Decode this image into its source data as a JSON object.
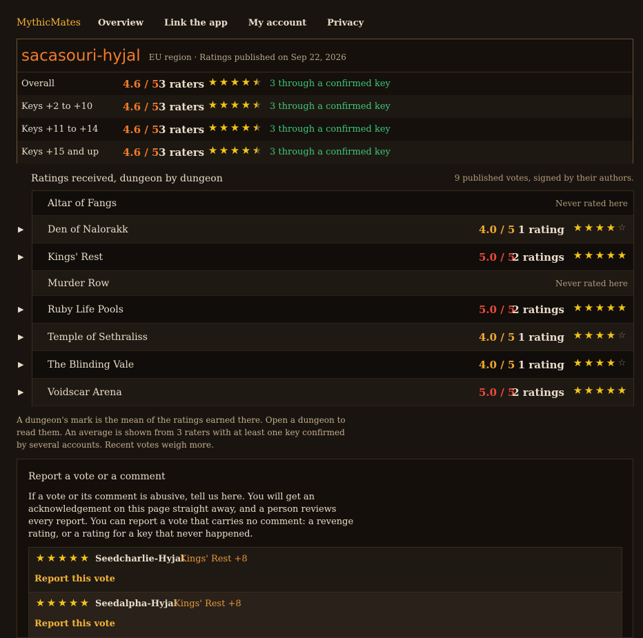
{
  "nav": {
    "brand": "MythicMates",
    "links": [
      "Overview",
      "Link the app",
      "My account",
      "Privacy"
    ]
  },
  "profile": {
    "name": "sacasouri-hyjal",
    "meta": "EU region · Ratings published on Sep 22, 2026",
    "rows": [
      {
        "label": "Overall",
        "score": "4.6 / 5",
        "raters": "3 raters",
        "stars": 4.5,
        "confirmed": "3 through a confirmed key"
      },
      {
        "label": "Keys +2 to +10",
        "score": "4.6 / 5",
        "raters": "3 raters",
        "stars": 4.5,
        "confirmed": "3 through a confirmed key"
      },
      {
        "label": "Keys +11 to +14",
        "score": "4.6 / 5",
        "raters": "3 raters",
        "stars": 4.5,
        "confirmed": "3 through a confirmed key"
      },
      {
        "label": "Keys +15 and up",
        "score": "4.6 / 5",
        "raters": "3 raters",
        "stars": 4.5,
        "confirmed": "3 through a confirmed key"
      }
    ]
  },
  "dungeons_section": {
    "title": "Ratings received, dungeon by dungeon",
    "subtitle": "9 published votes, signed by their authors.",
    "rows": [
      {
        "name": "Altar of Fangs",
        "never": "Never rated here"
      },
      {
        "name": "Den of Nalorakk",
        "score": "4.0 / 5",
        "count": "1 rating",
        "stars": 4
      },
      {
        "name": "Kings' Rest",
        "score": "5.0 / 5",
        "count": "2 ratings",
        "stars": 5
      },
      {
        "name": "Murder Row",
        "never": "Never rated here"
      },
      {
        "name": "Ruby Life Pools",
        "score": "5.0 / 5",
        "count": "2 ratings",
        "stars": 5
      },
      {
        "name": "Temple of Sethraliss",
        "score": "4.0 / 5",
        "count": "1 rating",
        "stars": 4
      },
      {
        "name": "The Blinding Vale",
        "score": "4.0 / 5",
        "count": "1 rating",
        "stars": 4
      },
      {
        "name": "Voidscar Arena",
        "score": "5.0 / 5",
        "count": "2 ratings",
        "stars": 5
      }
    ]
  },
  "footnote": "A dungeon's mark is the mean of the ratings earned there. Open a dungeon to read them. An average is shown from 3 raters with at least one key confirmed by several accounts. Recent votes weigh more.",
  "report": {
    "title": "Report a vote or a comment",
    "text": "If a vote or its comment is abusive, tell us here. You will get an acknowledgement on this page straight away, and a person reviews every report. You can report a vote that carries no comment: a revenge rating, or a rating for a key that never happened.",
    "votes": [
      {
        "stars": 5,
        "author": "Seedcharlie-Hyjal",
        "key": "Kings' Rest +8",
        "action": "Report this vote"
      },
      {
        "stars": 5,
        "author": "Seedalpha-Hyjal",
        "key": "Kings' Rest +8",
        "action": "Report this vote"
      }
    ]
  },
  "colors": {
    "score_orange": "#f07a2a",
    "score_gold": "#f0a830",
    "score_red": "#f04a3a",
    "confirmed_green": "#3cc77c",
    "star": "#f5c518"
  }
}
